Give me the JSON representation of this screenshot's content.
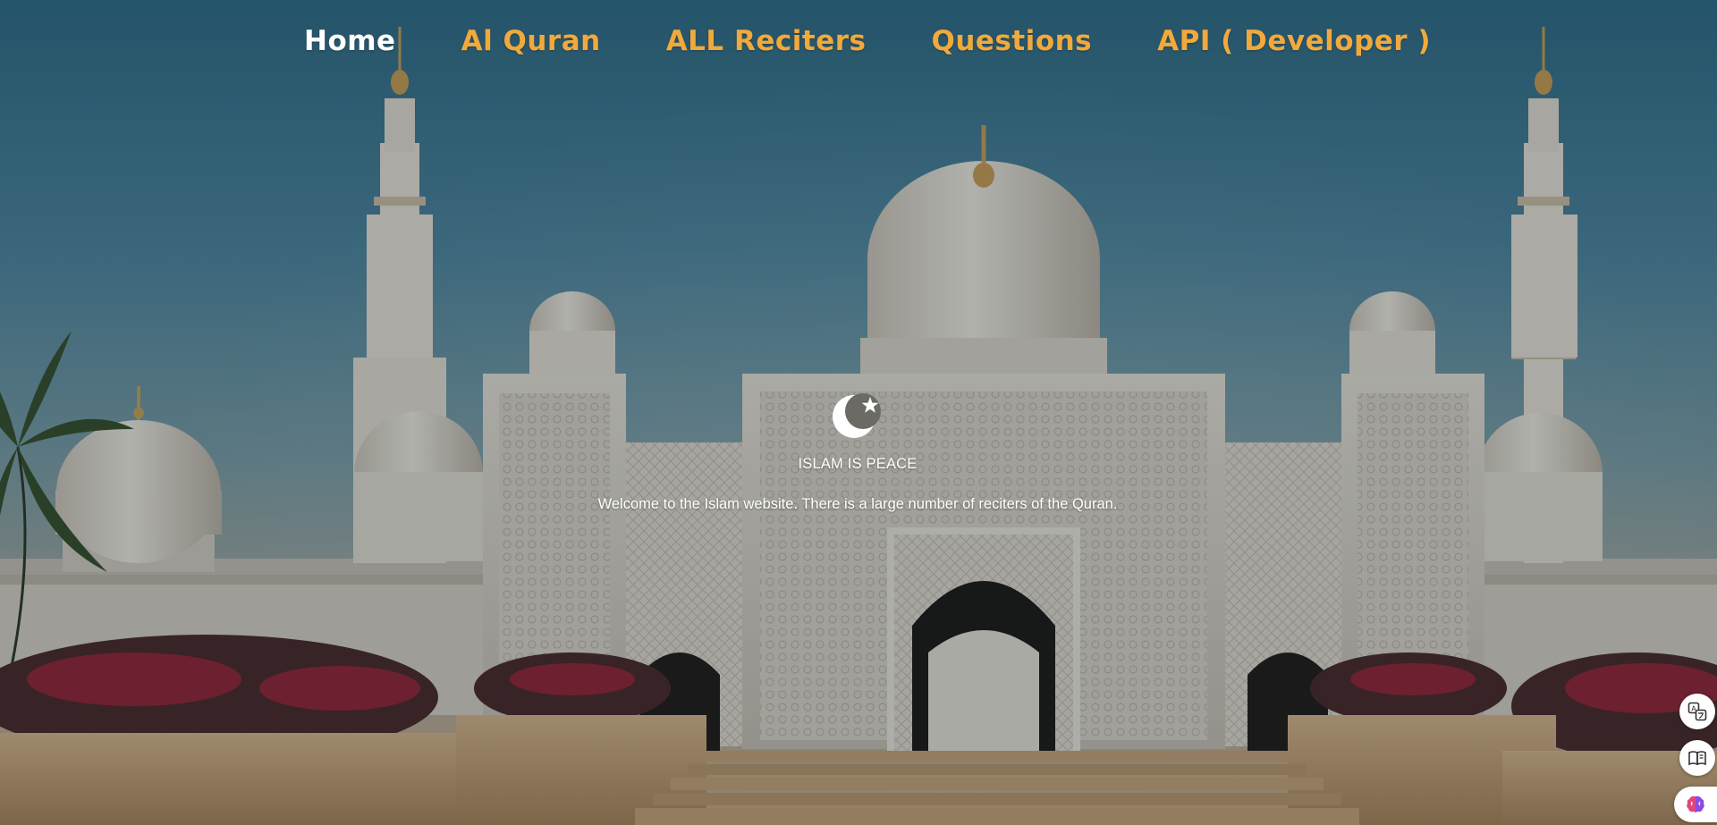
{
  "nav": {
    "items": [
      {
        "label": "Home",
        "active": true
      },
      {
        "label": "Al Quran",
        "active": false
      },
      {
        "label": "ALL Reciters",
        "active": false
      },
      {
        "label": "Questions",
        "active": false
      },
      {
        "label": "API ( Developer )",
        "active": false
      }
    ]
  },
  "hero": {
    "logo_icon": "crescent-star-icon",
    "title": "ISLAM IS PEACE",
    "text": "Welcome to the Islam website. There is a large number of reciters of the Quran."
  },
  "side_tools": {
    "items": [
      {
        "icon": "translate-icon"
      },
      {
        "icon": "reader-book-icon"
      },
      {
        "icon": "ai-brain-icon"
      }
    ]
  },
  "colors": {
    "nav_link": "#f2a93b",
    "nav_active": "#ffffff",
    "hero_text": "#ffffff"
  }
}
